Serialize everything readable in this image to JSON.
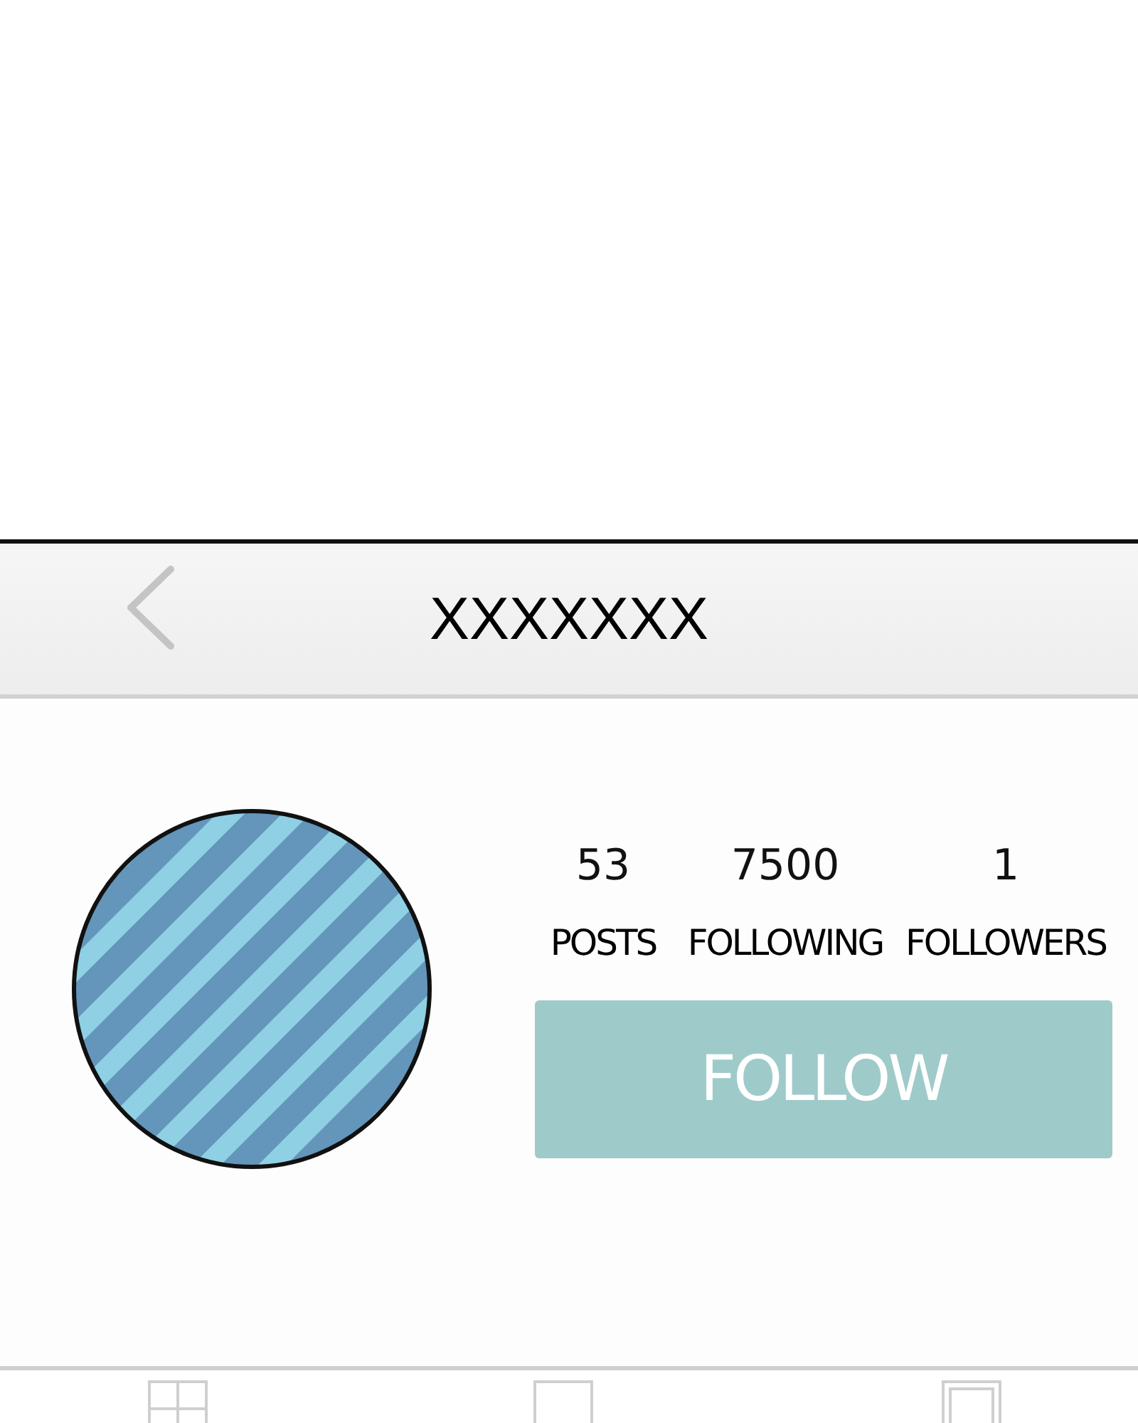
{
  "header": {
    "title": "XXXXXXX"
  },
  "stats": [
    {
      "value": "53",
      "label": "POSTS"
    },
    {
      "value": "7500",
      "label": "FOLLOWING"
    },
    {
      "value": "1",
      "label": "FOLLOWERS"
    }
  ],
  "follow_button": {
    "label": "FOLLOW"
  }
}
